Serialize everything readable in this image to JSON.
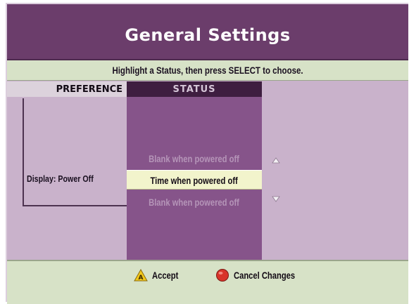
{
  "header": {
    "title": "General Settings"
  },
  "instruction": "Highlight a Status, then press SELECT to choose.",
  "columns": {
    "preference": "PREFERENCE",
    "status": "STATUS"
  },
  "preference": {
    "label": "Display: Power Off"
  },
  "status_options": [
    {
      "label": "Blank when powered off",
      "state": "dim"
    },
    {
      "label": "Time when powered off",
      "state": "selected"
    },
    {
      "label": "Blank when powered off",
      "state": "dim"
    }
  ],
  "footer": {
    "accept_label": "Accept",
    "cancel_label": "Cancel Changes",
    "accept_icon": "yellow-triangle-a-icon",
    "cancel_icon": "red-circle-icon"
  },
  "colors": {
    "title_bar": "#6b3d6b",
    "background": "#c9b2cb",
    "status_column": "#86548a",
    "highlight": "#f2f4cc",
    "info_bars": "#d7e2c7"
  }
}
